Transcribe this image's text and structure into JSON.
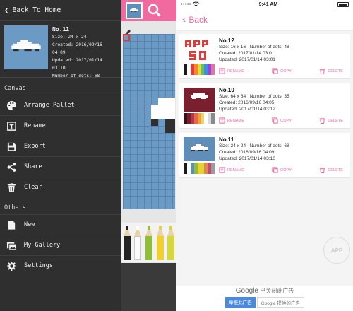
{
  "drawer": {
    "back_label": "Back To Home",
    "canvas": {
      "title": "No.11",
      "size": "Size: 24 x 24",
      "created": "Created: 2016/09/16 04:09",
      "updated": "Updated: 2017/01/14 03:10",
      "dots": "Number of dots: 68"
    },
    "canvas_section": "Canvas",
    "canvas_items": [
      {
        "label": "Arrange Pallet",
        "icon": "palette-icon"
      },
      {
        "label": "Rename",
        "icon": "rename-icon"
      },
      {
        "label": "Export",
        "icon": "export-icon"
      },
      {
        "label": "Share",
        "icon": "share-icon"
      },
      {
        "label": "Clear",
        "icon": "trash-icon"
      }
    ],
    "others_section": "Others",
    "other_items": [
      {
        "label": "New",
        "icon": "new-icon"
      },
      {
        "label": "My Gallery",
        "icon": "gallery-icon"
      },
      {
        "label": "Settings",
        "icon": "gear-icon"
      }
    ]
  },
  "gallery": {
    "status": {
      "carrier_dots": "•••••",
      "time": "9:41 AM"
    },
    "back_label": "Back",
    "items": [
      {
        "title": "No.12",
        "size": "Size: 16 x 16",
        "dots": "Number of dots: 48",
        "created": "Created: 2017/01/14 03:01",
        "updated": "Updated: 2017/01/14 03:01",
        "thumb_text": "APP SO"
      },
      {
        "title": "No.10",
        "size": "Size: 64 x 64",
        "dots": "Number of dots: 35",
        "created": "Created: 2016/09/16 04:05",
        "updated": "Updated: 2017/01/14 03:12"
      },
      {
        "title": "No.11",
        "size": "Size: 24 x 24",
        "dots": "Number of dots: 68",
        "created": "Created: 2016/09/16 04:09",
        "updated": "Updated: 2017/01/14 03:10"
      }
    ],
    "actions": {
      "rename": "RENAME",
      "copy": "COPY",
      "delete": "DELETE"
    },
    "watermark": "APP",
    "ad": {
      "brand": "Google",
      "closed": "已关闭此广告",
      "report": "举报此广告",
      "provided": "Google 提供的广告"
    }
  },
  "colors": {
    "accent_pink": "#f06aa0",
    "drawer_bg": "#2f2f2f",
    "canvas_blue": "#6b9bc5",
    "ad_blue": "#4a89dc"
  }
}
